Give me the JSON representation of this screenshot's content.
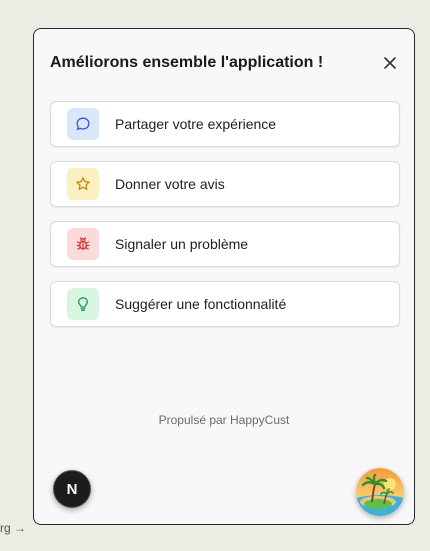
{
  "background": {
    "link_text": "rg →"
  },
  "widget": {
    "title": "Améliorons ensemble l'application !",
    "close_icon": "close-icon",
    "options": [
      {
        "label": "Partager votre expérience",
        "icon": "chat-bubble-icon",
        "icon_bg": "#dbe6fb",
        "icon_color": "#2f5fd0"
      },
      {
        "label": "Donner votre avis",
        "icon": "star-icon",
        "icon_bg": "#fbf0c2",
        "icon_color": "#c98a06"
      },
      {
        "label": "Signaler un problème",
        "icon": "bug-icon",
        "icon_bg": "#fbdada",
        "icon_color": "#d32f2f"
      },
      {
        "label": "Suggérer une fonctionnalité",
        "icon": "lightbulb-icon",
        "icon_bg": "#d8f5e2",
        "icon_color": "#1f9a4f"
      }
    ],
    "footer": "Propulsé par HappyCust"
  },
  "next_button": {
    "letter": "N",
    "icon": "nextjs-logo-icon"
  },
  "launcher": {
    "icon": "tropical-island-avatar-icon"
  }
}
